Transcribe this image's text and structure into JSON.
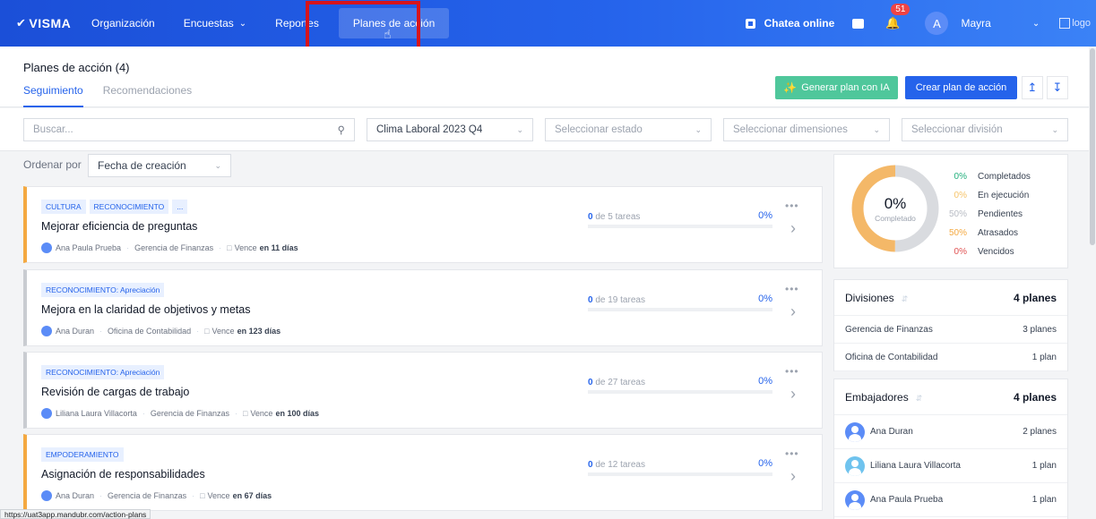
{
  "nav": {
    "brand": "VISMA",
    "items": [
      {
        "label": "Organización"
      },
      {
        "label": "Encuestas",
        "has_dropdown": true
      },
      {
        "label": "Reportes"
      },
      {
        "label": "Planes de acción",
        "active": true
      }
    ],
    "chat_label": "Chatea online",
    "notification_count": "51",
    "avatar_letter": "A",
    "user_name": "Mayra",
    "logo_alt": "logo"
  },
  "header": {
    "title": "Planes de acción (4)",
    "tabs": [
      {
        "label": "Seguimiento",
        "active": true
      },
      {
        "label": "Recomendaciones"
      }
    ],
    "ai_button": "Generar plan con IA",
    "create_button": "Crear plan de acción"
  },
  "filters": {
    "search_placeholder": "Buscar...",
    "survey_value": "Clima Laboral 2023 Q4",
    "state_placeholder": "Seleccionar estado",
    "dimensions_placeholder": "Seleccionar dimensiones",
    "division_placeholder": "Seleccionar división"
  },
  "sort": {
    "label": "Ordenar por",
    "value": "Fecha de creación"
  },
  "plans": [
    {
      "tags": [
        "CULTURA",
        "RECONOCIMIENTO",
        "..."
      ],
      "title": "Mejorar eficiencia de preguntas",
      "owner": "Ana Paula Prueba",
      "division": "Gerencia de Finanzas",
      "due_prefix": "Vence",
      "due": "en 11 días",
      "done": "0",
      "total_text": "de 5 tareas",
      "percent": "0%",
      "progress": 0,
      "accent": "orange"
    },
    {
      "tags": [
        "RECONOCIMIENTO: Apreciación"
      ],
      "title": "Mejora en la claridad de objetivos y metas",
      "owner": "Ana Duran",
      "division": "Oficina de Contabilidad",
      "due_prefix": "Vence",
      "due": "en 123 días",
      "done": "0",
      "total_text": "de 19 tareas",
      "percent": "0%",
      "progress": 0,
      "accent": "gray"
    },
    {
      "tags": [
        "RECONOCIMIENTO: Apreciación"
      ],
      "title": "Revisión de cargas de trabajo",
      "owner": "Liliana Laura Villacorta",
      "division": "Gerencia de Finanzas",
      "due_prefix": "Vence",
      "due": "en 100 días",
      "done": "0",
      "total_text": "de 27 tareas",
      "percent": "0%",
      "progress": 0,
      "accent": "gray"
    },
    {
      "tags": [
        "EMPODERAMIENTO"
      ],
      "title": "Asignación de responsabilidades",
      "owner": "Ana Duran",
      "division": "Gerencia de Finanzas",
      "due_prefix": "Vence",
      "due": "en 67 días",
      "done": "0",
      "total_text": "de 12 tareas",
      "percent": "0%",
      "progress": 0,
      "accent": "orange"
    }
  ],
  "summary": {
    "center_value": "0%",
    "center_label": "Completado",
    "legend": [
      {
        "pct": "0%",
        "label": "Completados",
        "color": "#22b07d"
      },
      {
        "pct": "0%",
        "label": "En ejecución",
        "color": "#f6c46a"
      },
      {
        "pct": "50%",
        "label": "Pendientes",
        "color": "#b8bcc4"
      },
      {
        "pct": "50%",
        "label": "Atrasados",
        "color": "#f4a941"
      },
      {
        "pct": "0%",
        "label": "Vencidos",
        "color": "#e05252"
      }
    ],
    "donut_segments": [
      {
        "value": 50,
        "color": "#d9dbdf"
      },
      {
        "value": 50,
        "color": "#f4b868"
      }
    ]
  },
  "divisions": {
    "title": "Divisiones",
    "count": "4 planes",
    "rows": [
      {
        "name": "Gerencia de Finanzas",
        "count": "3 planes"
      },
      {
        "name": "Oficina de Contabilidad",
        "count": "1 plan"
      }
    ]
  },
  "ambassadors": {
    "title": "Embajadores",
    "count": "4 planes",
    "rows": [
      {
        "name": "Ana Duran",
        "count": "2 planes",
        "avatar": "blue"
      },
      {
        "name": "Liliana Laura Villacorta",
        "count": "1 plan",
        "avatar": "light"
      },
      {
        "name": "Ana Paula Prueba",
        "count": "1 plan",
        "avatar": "blue"
      }
    ]
  },
  "status_url": "https://uat3app.mandubr.com/action-plans"
}
